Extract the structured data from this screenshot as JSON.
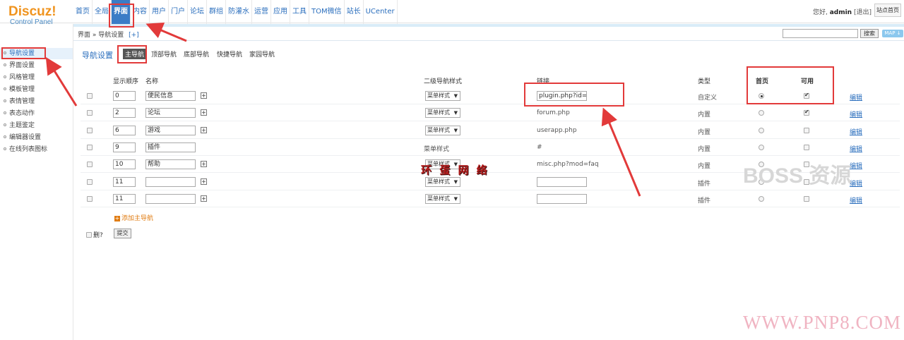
{
  "app": {
    "logo_title": "Discuz!",
    "logo_subtitle": "Control Panel"
  },
  "top_nav": [
    "首页",
    "全局",
    "界面",
    "内容",
    "用户",
    "门户",
    "论坛",
    "群组",
    "防灌水",
    "运营",
    "应用",
    "工具",
    "TOM微信",
    "站长",
    "UCenter"
  ],
  "top_nav_active": "界面",
  "user": {
    "greeting": "您好,",
    "name": "admin",
    "logout": "[退出]",
    "site_home": "站点首页"
  },
  "breadcrumb": {
    "text": "界面 » 导航设置",
    "plus": "[+]"
  },
  "search": {
    "button": "搜索",
    "map": "MAP ↓"
  },
  "sidebar": {
    "items": [
      "导航设置",
      "界面设置",
      "风格管理",
      "模板管理",
      "表情管理",
      "表态动作",
      "主题鉴定",
      "编辑器设置",
      "在线列表图标"
    ],
    "active": "导航设置"
  },
  "main": {
    "title": "导航设置",
    "tabs": [
      "主导航",
      "顶部导航",
      "底部导航",
      "快捷导航",
      "家园导航"
    ],
    "active_tab": "主导航",
    "headers": {
      "order": "显示顺序",
      "name": "名称",
      "sub_style": "二级导航样式",
      "link": "链接",
      "type": "类型",
      "home": "首页",
      "enabled": "可用"
    },
    "rows": [
      {
        "order": "0",
        "name": "便民信息",
        "style": "菜单样式",
        "style_select": true,
        "link": "plugin.php?id=tc",
        "link_input": true,
        "type": "自定义",
        "home": true,
        "enabled": true,
        "plus": true,
        "edit": "编辑"
      },
      {
        "order": "2",
        "name": "论坛",
        "style": "菜单样式",
        "style_select": true,
        "link": "forum.php",
        "link_input": false,
        "type": "内置",
        "home": false,
        "enabled": true,
        "plus": true,
        "edit": "编辑"
      },
      {
        "order": "6",
        "name": "游戏",
        "style": "菜单样式",
        "style_select": true,
        "link": "userapp.php",
        "link_input": false,
        "type": "内置",
        "home": false,
        "enabled": false,
        "plus": true,
        "edit": "编辑"
      },
      {
        "order": "9",
        "name": "插件",
        "style": "菜单样式",
        "style_select": false,
        "link": "#",
        "link_input": false,
        "type": "内置",
        "home": false,
        "enabled": false,
        "plus": false,
        "edit": "编辑"
      },
      {
        "order": "10",
        "name": "帮助",
        "style": "菜单样式",
        "style_select": true,
        "link": "misc.php?mod=faq",
        "link_input": false,
        "type": "内置",
        "home": false,
        "enabled": false,
        "plus": true,
        "edit": "编辑"
      },
      {
        "order": "11",
        "name": "",
        "style": "菜单样式",
        "style_select": true,
        "link": "",
        "link_input": true,
        "type": "插件",
        "home": false,
        "enabled": false,
        "plus": true,
        "edit": "编辑"
      },
      {
        "order": "11",
        "name": "",
        "style": "菜单样式",
        "style_select": true,
        "link": "",
        "link_input": true,
        "type": "插件",
        "home": false,
        "enabled": false,
        "plus": true,
        "edit": "编辑"
      }
    ],
    "add_nav": "添加主导航",
    "delete_label": "删?",
    "submit": "提交"
  },
  "watermarks": {
    "center": "环 蛋 网 络",
    "boss": "BOSS 资源",
    "url": "WWW.PNP8.COM"
  },
  "colors": {
    "accent": "#3b7cc6",
    "annotation": "#e23a3a",
    "logo": "#f0941f"
  }
}
